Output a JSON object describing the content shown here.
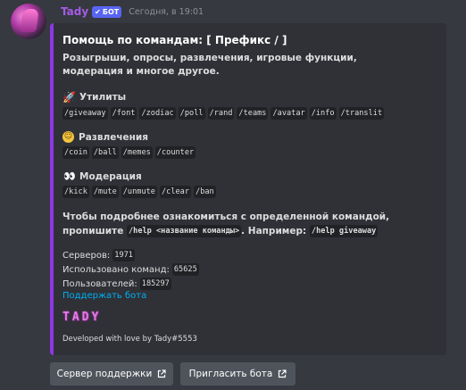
{
  "message": {
    "author": "Tady",
    "bot_badge": "БОТ",
    "timestamp": "Сегодня, в 19:01"
  },
  "embed": {
    "accent_color": "#8f36e5",
    "title": "Помощь по командам: [ Префикс / ]",
    "description": "Розыгрыши, опросы, развлечения, игровые функции, модерация и многое другое.",
    "sections": [
      {
        "icon": "rocket-icon",
        "name": "Утилиты",
        "commands": [
          "/giveaway",
          "/font",
          "/zodiac",
          "/poll",
          "/rand",
          "/teams",
          "/avatar",
          "/info",
          "/translit"
        ]
      },
      {
        "icon": "smiley-icon",
        "name": "Развлечения",
        "commands": [
          "/coin",
          "/ball",
          "/memes",
          "/counter"
        ]
      },
      {
        "icon": "eyes-icon",
        "name": "Модерация",
        "commands": [
          "/kick",
          "/mute",
          "/unmute",
          "/clear",
          "/ban"
        ]
      }
    ],
    "howto": {
      "text1": "Чтобы подробнее ознакомиться с определенной командой, пропишите",
      "code1": "/help <название команды>",
      "text2": ". Например:",
      "code2": "/help giveaway"
    },
    "stats": [
      {
        "label": "Серверов:",
        "value": "1971"
      },
      {
        "label": "Использовано команд:",
        "value": "65625"
      },
      {
        "label": "Пользователей:",
        "value": "185297"
      }
    ],
    "support_link": "Поддержать бота",
    "logo_text": "TADY",
    "footer": "Developed with love by Tady#5553"
  },
  "buttons": [
    {
      "label": "Сервер поддержки",
      "icon": "external-link-icon"
    },
    {
      "label": "Пригласить бота",
      "icon": "external-link-icon"
    }
  ]
}
